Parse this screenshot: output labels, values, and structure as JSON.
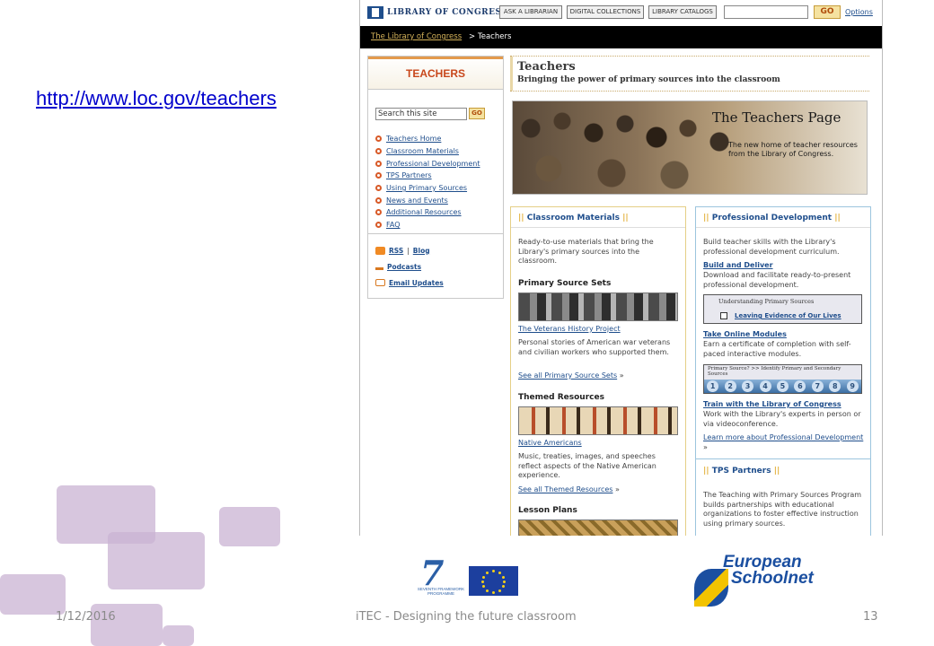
{
  "slide": {
    "link_text": "http://www.loc.gov/teachers",
    "footer": {
      "date": "1/12/2016",
      "title": "iTEC - Designing the future classroom",
      "page_number": "13"
    },
    "logos": {
      "fp7_caption": "SEVENTH FRAMEWORK PROGRAMME",
      "european_schoolnet_line1": "European",
      "european_schoolnet_line2": "Schoolnet"
    }
  },
  "loc_page": {
    "header": {
      "logo_text": "LIBRARY OF CONGRESS",
      "buttons": [
        "ASK A LIBRARIAN",
        "DIGITAL COLLECTIONS",
        "LIBRARY CATALOGS"
      ],
      "search_value": "",
      "go_label": "GO",
      "options_label": "Options"
    },
    "breadcrumb": {
      "home": "The Library of Congress",
      "separator": ">",
      "current": "Teachers"
    },
    "sidebar": {
      "title": "TEACHERS",
      "search_value": "Search this site",
      "go_label": "GO",
      "nav_items": [
        "Teachers Home",
        "Classroom Materials",
        "Professional Development",
        "TPS Partners",
        "Using Primary Sources",
        "News and Events",
        "Additional Resources",
        "FAQ"
      ],
      "rss_label": "RSS",
      "separator": "|",
      "blog_label": "Blog",
      "podcasts_label": "Podcasts",
      "email_label": "Email Updates"
    },
    "main": {
      "title": "Teachers",
      "subtitle": "Bringing the power of primary sources into the classroom",
      "banner_title": "The Teachers Page",
      "banner_subtitle": "The new home of teacher resources from the Library of Congress."
    },
    "classroom_materials": {
      "pipes": "||",
      "heading": "Classroom Materials",
      "intro": "Ready-to-use materials that bring the Library's primary sources into the classroom.",
      "primary_source_sets": "Primary Source Sets",
      "veterans_link": "The Veterans History Project",
      "veterans_desc": "Personal stories of American war veterans and civilian workers who supported them.",
      "see_all_sets": "See all Primary Source Sets",
      "themed_resources": "Themed Resources",
      "native_link": "Native Americans",
      "native_desc": "Music, treaties, images, and speeches reflect aspects of the Native American experience.",
      "see_all_themed": "See all Themed Resources",
      "lesson_plans": "Lesson Plans",
      "arrow": "»"
    },
    "professional_development": {
      "heading": "Professional Development",
      "intro": "Build teacher skills with the Library's professional development curriculum.",
      "build_link": "Build and Deliver",
      "build_desc": "Download and facilitate ready-to-present professional development.",
      "thumb1_title": "Understanding Primary Sources",
      "thumb1_item": "Leaving Evidence of Our Lives",
      "online_link": "Take Online Modules",
      "online_desc": "Earn a certificate of completion with self-paced interactive modules.",
      "thumb2_title": "Primary Source? >> Identify Primary and Secondary Sources",
      "thumb2_numbers": [
        "1",
        "2",
        "3",
        "4",
        "5",
        "6",
        "7",
        "8",
        "9"
      ],
      "train_link": "Train with the Library of Congress",
      "train_desc": "Work with the Library's experts in person or via videoconference.",
      "learn_more": "Learn more about Professional Development",
      "arrow": "»"
    },
    "tps_partners": {
      "heading": "TPS Partners",
      "desc": "The Teaching with Primary Sources Program builds partnerships with educational organizations to foster effective instruction using primary sources."
    }
  }
}
